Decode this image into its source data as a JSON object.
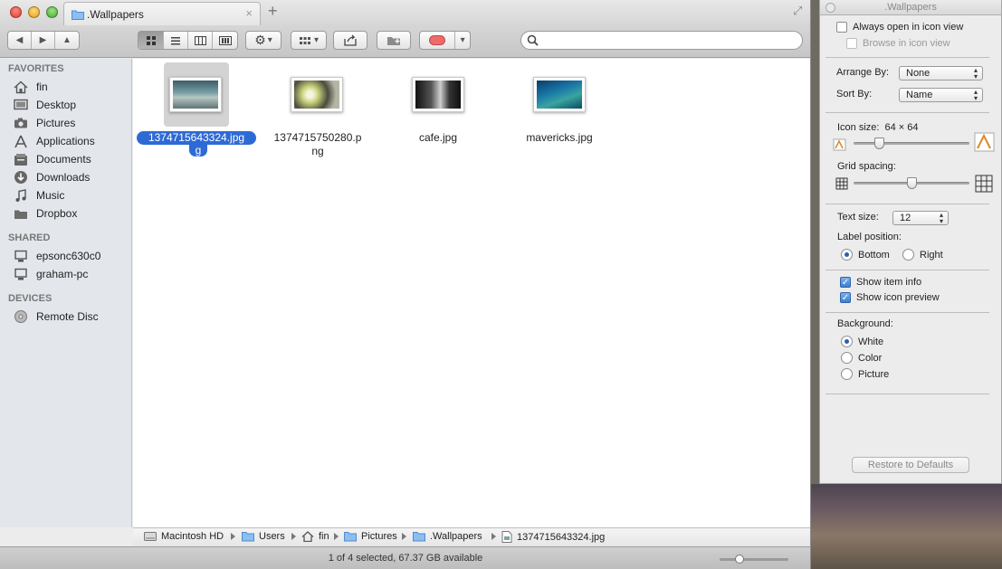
{
  "window": {
    "tab_title": ".Wallpapers",
    "close_tab_glyph": "×",
    "new_tab_glyph": "+",
    "fullscreen_glyph": "⤢"
  },
  "toolbar": {
    "back_glyph": "◀",
    "forward_glyph": "▶",
    "up_glyph": "▲",
    "dropdown_glyph": "▾",
    "view_mode_selected": "icon",
    "search": {
      "value": "",
      "placeholder": ""
    },
    "tag_color": "#f06a6a"
  },
  "sidebar": {
    "favorites_header": "FAVORITES",
    "favorites": [
      {
        "label": "fin",
        "icon": "home-icon"
      },
      {
        "label": "Desktop",
        "icon": "desktop-icon"
      },
      {
        "label": "Pictures",
        "icon": "camera-icon"
      },
      {
        "label": "Applications",
        "icon": "applications-icon"
      },
      {
        "label": "Documents",
        "icon": "documents-icon"
      },
      {
        "label": "Downloads",
        "icon": "downloads-icon"
      },
      {
        "label": "Music",
        "icon": "music-icon"
      },
      {
        "label": "Dropbox",
        "icon": "folder-icon"
      }
    ],
    "shared_header": "SHARED",
    "shared": [
      {
        "label": "epsonc630c0",
        "icon": "computer-icon"
      },
      {
        "label": "graham-pc",
        "icon": "computer-icon"
      }
    ],
    "devices_header": "DEVICES",
    "devices": [
      {
        "label": "Remote Disc",
        "icon": "disc-icon"
      }
    ]
  },
  "files": [
    {
      "name_line1": "1374715643324.jpg",
      "name_line2": "g",
      "selected": true
    },
    {
      "name_line1": "1374715750280.p",
      "name_line2": "ng",
      "selected": false
    },
    {
      "name_line1": "cafe.jpg",
      "name_line2": "",
      "selected": false
    },
    {
      "name_line1": "mavericks.jpg",
      "name_line2": "",
      "selected": false
    }
  ],
  "pathbar": {
    "crumbs": [
      "Macintosh HD",
      "Users",
      "fin",
      "Pictures",
      ".Wallpapers",
      "1374715643324.jpg"
    ]
  },
  "status": {
    "text": "1 of 4 selected, 67.37 GB available",
    "zoom_fraction": 0.25
  },
  "inspector": {
    "title": ".Wallpapers",
    "always_open_label": "Always open in icon view",
    "always_open_checked": false,
    "browse_label": "Browse in icon view",
    "browse_checked": false,
    "arrange_by_label": "Arrange By:",
    "arrange_by_value": "None",
    "sort_by_label": "Sort By:",
    "sort_by_value": "Name",
    "icon_size_label": "Icon size:",
    "icon_size_value": "64 × 64",
    "icon_size_fraction": 0.2,
    "grid_spacing_label": "Grid spacing:",
    "grid_spacing_fraction": 0.5,
    "text_size_label": "Text size:",
    "text_size_value": "12",
    "label_position_label": "Label position:",
    "label_position_options": [
      "Bottom",
      "Right"
    ],
    "label_position_selected": "Bottom",
    "show_item_info_label": "Show item info",
    "show_item_info_checked": true,
    "show_icon_preview_label": "Show icon preview",
    "show_icon_preview_checked": true,
    "background_label": "Background:",
    "background_options": [
      "White",
      "Color",
      "Picture"
    ],
    "background_selected": "White",
    "restore_label": "Restore to Defaults",
    "check_glyph": "✓"
  }
}
